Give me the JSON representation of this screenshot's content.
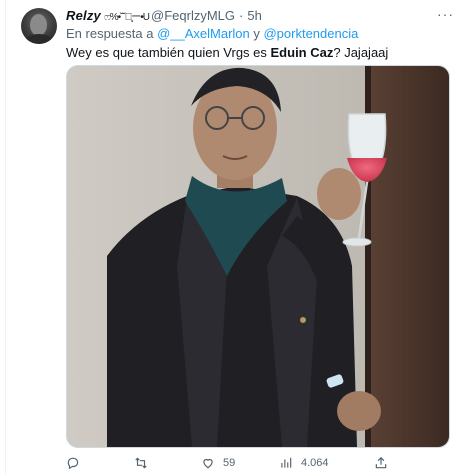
{
  "tweet": {
    "display_name": "Relzy",
    "name_glyphs": "ෆ%•˘˘ー̥ー•U",
    "handle": "@FeqrlzyMLG",
    "separator": "·",
    "time": "5h",
    "reply_prefix": "En respuesta a ",
    "reply_mention_1": "@__AxelMarlon",
    "reply_join": " y ",
    "reply_mention_2": "@porktendencia",
    "text_before": "Wey es que también quien Vrgs es ",
    "text_bold": "Eduin Caz",
    "text_after": "? Jajajaaj"
  },
  "actions": {
    "reply_count": "",
    "retweet_count": "",
    "like_count": "59",
    "views_count": "4.064"
  },
  "icons": [
    "more-icon",
    "reply-icon",
    "retweet-icon",
    "like-icon",
    "views-icon",
    "share-icon"
  ],
  "colors": {
    "link": "#1d9bf0",
    "muted": "#536471",
    "text": "#0f1419"
  }
}
